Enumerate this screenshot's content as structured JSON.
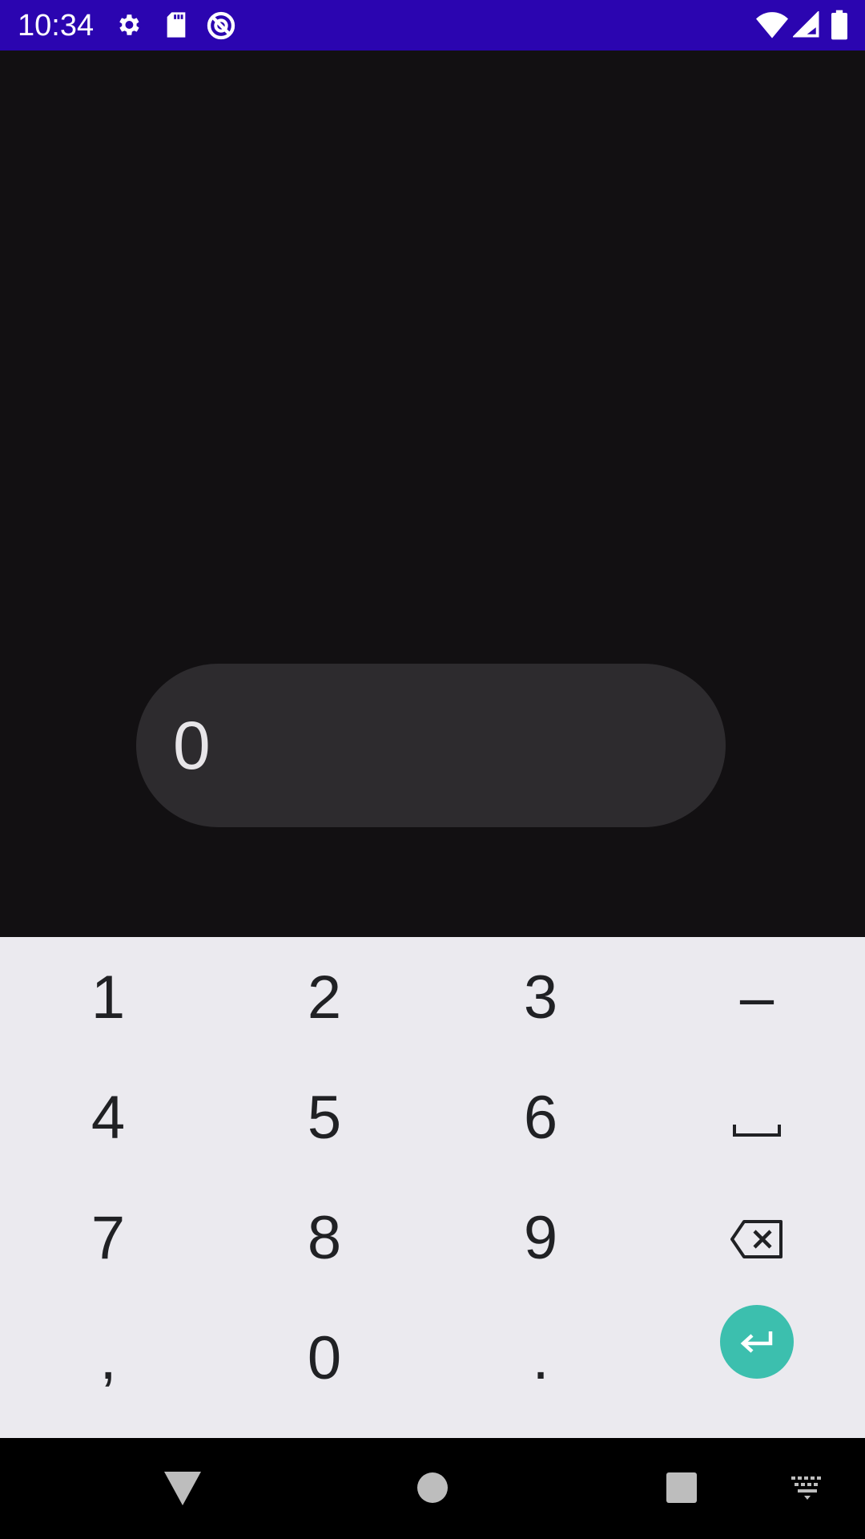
{
  "status_bar": {
    "time": "10:34",
    "icons": [
      "settings-icon",
      "sd-card-icon",
      "data-saver-icon",
      "wifi-icon",
      "cell-signal-icon",
      "battery-icon"
    ],
    "background": "#2b05b0"
  },
  "number_field": {
    "value": "0"
  },
  "keyboard": {
    "keys": [
      "1",
      "2",
      "3",
      "–",
      "4",
      "5",
      "6",
      "7",
      "8",
      "9",
      ",",
      "0",
      "."
    ],
    "space_key": "space-icon",
    "backspace_key": "backspace-icon",
    "enter_key": "enter-icon",
    "enter_color": "#3cbfae"
  },
  "nav_bar": {
    "buttons": [
      "back-icon",
      "home-icon",
      "recents-icon",
      "keyboard-switch-icon"
    ]
  }
}
